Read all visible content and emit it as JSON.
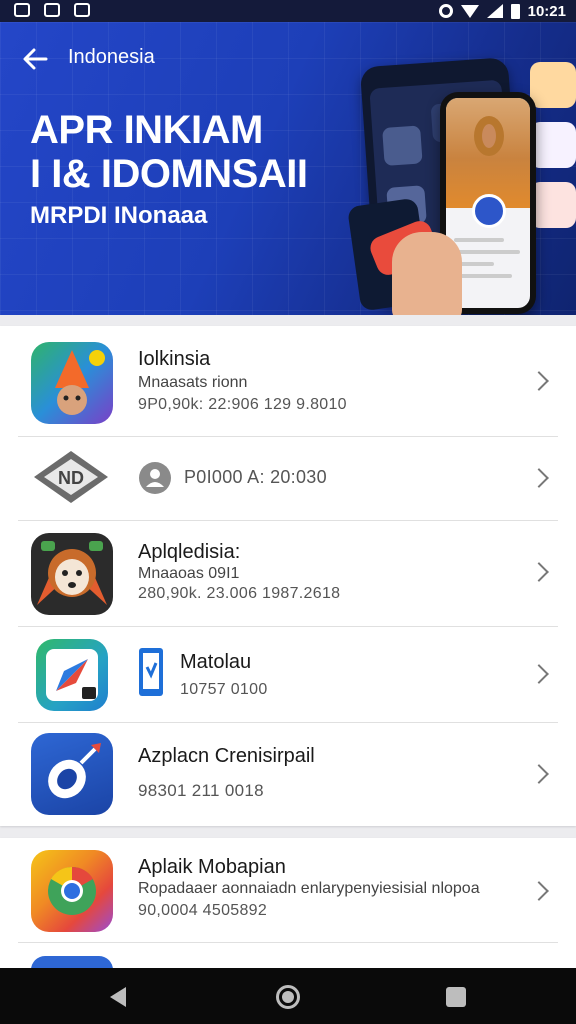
{
  "status_bar": {
    "time": "10:21"
  },
  "header": {
    "nav_title": "Indonesia",
    "hero_line1": "APR INKIAM",
    "hero_line2": "I I& IDOMNSAII",
    "hero_line3": "MRPDI INonaaa"
  },
  "list": [
    {
      "title": "Iolkinsia",
      "subtitle": "Mnaasats rionn",
      "meta": "9P0,90k: 22:906 129 9.8010",
      "icon": "hat-character-app-icon"
    },
    {
      "title": "",
      "subtitle": "",
      "meta": "P0I000 A: 20:030",
      "icon": "diamond-logo-app-icon"
    },
    {
      "title": "Aplqledisia:",
      "subtitle": "Mnaaoas 09I1",
      "meta": "280,90k. 23.006 1987.2618",
      "icon": "monkey-face-app-icon"
    },
    {
      "title": "Matolau",
      "subtitle": "",
      "meta": "10757 0100",
      "icon": "compass-app-icon"
    },
    {
      "title": "Azplacn Crenisirpail",
      "subtitle": "",
      "meta": "98301 211 0018",
      "icon": "rocket-app-icon"
    },
    {
      "title": "Aplaik Mobapian",
      "subtitle": "Ropadaaer aonnaiadn enlarypenyiesisial nlopoa",
      "meta": "90,0004 4505892",
      "icon": "chrome-app-icon"
    }
  ]
}
